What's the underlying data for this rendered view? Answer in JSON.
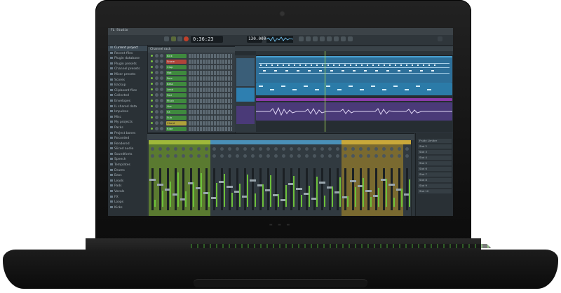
{
  "app": {
    "title": "FL Studio",
    "tempo": "130.000",
    "time_display": "0:36:23",
    "pattern": "Pattern 1"
  },
  "browser": {
    "items": [
      {
        "label": "Current project",
        "selected": true
      },
      {
        "label": "Recent files"
      },
      {
        "label": "Plugin database"
      },
      {
        "label": "Plugin presets"
      },
      {
        "label": "Channel presets"
      },
      {
        "label": "Mixer presets"
      },
      {
        "label": "Scores"
      },
      {
        "label": "Backup"
      },
      {
        "label": "Clipboard files"
      },
      {
        "label": "Collected"
      },
      {
        "label": "Envelopes"
      },
      {
        "label": "IL shared data"
      },
      {
        "label": "Impulses"
      },
      {
        "label": "Misc"
      },
      {
        "label": "My projects"
      },
      {
        "label": "Packs"
      },
      {
        "label": "Project bones"
      },
      {
        "label": "Recorded"
      },
      {
        "label": "Rendered"
      },
      {
        "label": "Sliced audio"
      },
      {
        "label": "Soundfonts"
      },
      {
        "label": "Speech"
      },
      {
        "label": "Templates"
      },
      {
        "label": "Drums"
      },
      {
        "label": "Bass"
      },
      {
        "label": "Leads"
      },
      {
        "label": "Pads"
      },
      {
        "label": "Vocals"
      },
      {
        "label": "FX"
      },
      {
        "label": "Loops"
      },
      {
        "label": "Kicks"
      }
    ]
  },
  "channel_rack": {
    "title": "Channel rack",
    "channels": [
      {
        "name": "Kick",
        "color": "green"
      },
      {
        "name": "Snare",
        "color": "red"
      },
      {
        "name": "Clap",
        "color": "green"
      },
      {
        "name": "Hat",
        "color": "green"
      },
      {
        "name": "Perc",
        "color": "green"
      },
      {
        "name": "Bass",
        "color": "green"
      },
      {
        "name": "Lead",
        "color": "green"
      },
      {
        "name": "Pad",
        "color": "green"
      },
      {
        "name": "Pluck",
        "color": "green"
      },
      {
        "name": "Vox",
        "color": "green"
      },
      {
        "name": "FX",
        "color": "green"
      },
      {
        "name": "Sub",
        "color": "green"
      },
      {
        "name": "Chord",
        "color": "yellow"
      },
      {
        "name": "Ride",
        "color": "green"
      }
    ]
  },
  "mixer": {
    "fx_slots": [
      "Fruity Limiter",
      "Slot 2",
      "Slot 3",
      "Slot 4",
      "Slot 5",
      "Slot 6",
      "Slot 7",
      "Slot 8",
      "Slot 9",
      "Slot 10"
    ]
  },
  "colors": {
    "accent_green": "#7ac143",
    "clip_blue": "#2d6f99",
    "clip_purple": "#4a3a78",
    "record_red": "#c0402a"
  }
}
